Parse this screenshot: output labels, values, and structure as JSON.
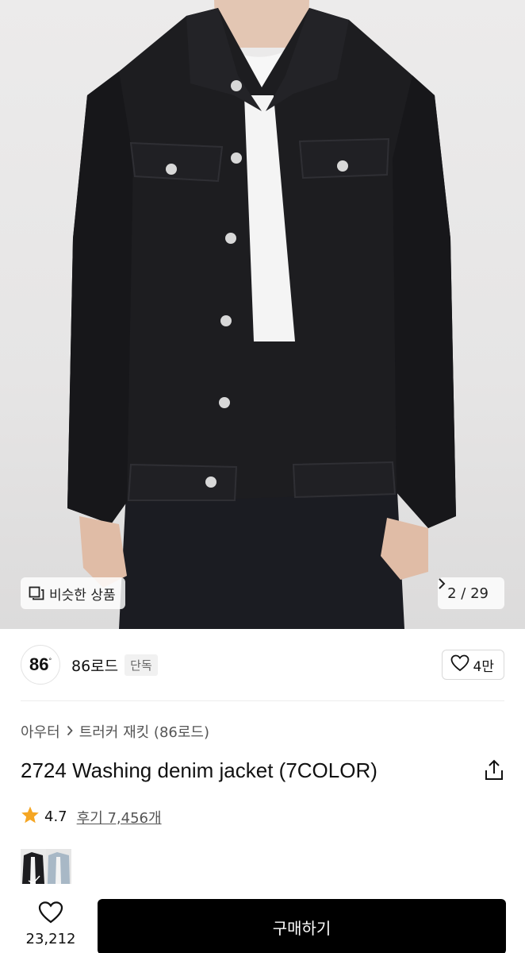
{
  "hero": {
    "similar_label": "비슷한 상품",
    "counter": "2 / 29",
    "icons": {
      "similar": "similar-items-icon",
      "next": "chevron-right-icon"
    }
  },
  "brand": {
    "logo_text": "86",
    "logo_mark": "°",
    "name": "86로드",
    "badge": "단독",
    "likes": "4만",
    "like_icon": "heart-icon"
  },
  "breadcrumb": {
    "category": "아우터",
    "subcategory": "트러커 재킷 (86로드)"
  },
  "product": {
    "title": "2724 Washing denim jacket (7COLOR)",
    "rating": "4.7",
    "reviews": "후기 7,456개"
  },
  "bottom": {
    "wish_count": "23,212",
    "buy_label": "구매하기"
  },
  "colors": {
    "accent_star": "#f5a623",
    "buy_button": "#000000"
  }
}
